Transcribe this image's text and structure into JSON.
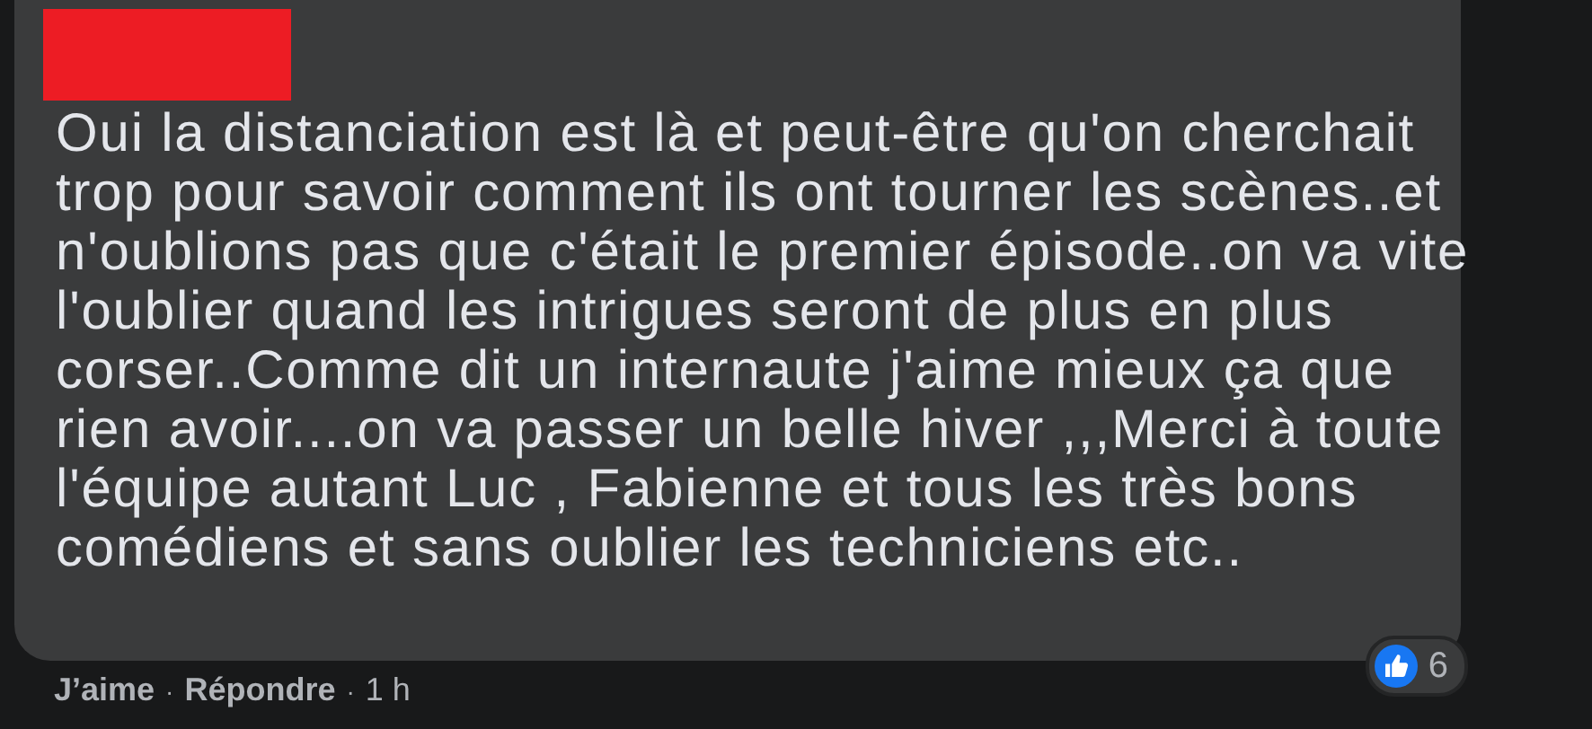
{
  "comment": {
    "author_redacted": true,
    "text": "Oui la distanciation est là et peut-être qu'on cherchait\ntrop pour savoir comment ils ont tourner les scènes..et\nn'oublions pas que c'était le premier épisode..on va vite\nl'oublier quand les intrigues seront de plus en plus\ncorser..Comme dit un internaute j'aime mieux ça que\nrien avoir....on va passer un belle hiver ,,,Merci à toute\nl'équipe autant Luc , Fabienne et tous les très bons\ncomédiens et sans oublier les techniciens etc..",
    "reactions": {
      "count": "6"
    }
  },
  "actions": [
    {
      "label": "J’aime"
    },
    {
      "label": "Répondre"
    }
  ],
  "separator": "·",
  "time": "1 h"
}
